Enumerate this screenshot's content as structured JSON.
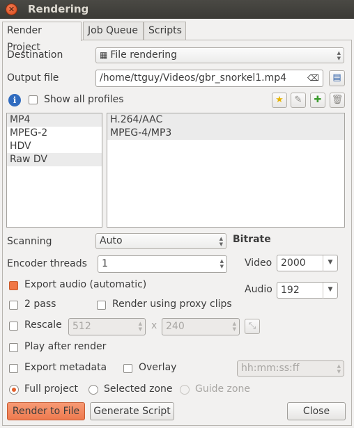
{
  "window": {
    "title": "Rendering"
  },
  "tabs": [
    "Render Project",
    "Job Queue",
    "Scripts"
  ],
  "destination": {
    "label": "Destination",
    "value": "File rendering"
  },
  "output": {
    "label": "Output file",
    "value": "/home/ttguy/Videos/gbr_snorkel1.mp4"
  },
  "profiles": {
    "show_all_label": "Show all profiles",
    "formats": [
      "MP4",
      "MPEG-2",
      "HDV",
      "Raw DV"
    ],
    "codecs": [
      "H.264/AAC",
      "MPEG-4/MP3"
    ]
  },
  "scanning": {
    "label": "Scanning",
    "value": "Auto"
  },
  "encoder": {
    "label": "Encoder threads",
    "value": "1"
  },
  "bitrate": {
    "title": "Bitrate",
    "video_label": "Video",
    "video_value": "2000",
    "audio_label": "Audio",
    "audio_value": "192"
  },
  "options": {
    "export_audio": "Export audio (automatic)",
    "two_pass": "2 pass",
    "proxy": "Render using proxy clips",
    "rescale": "Rescale",
    "rescale_w": "512",
    "rescale_x": "x",
    "rescale_h": "240",
    "play_after": "Play after render",
    "export_metadata": "Export metadata",
    "overlay": "Overlay",
    "overlay_value": "hh:mm:ss:ff"
  },
  "zones": {
    "full": "Full project",
    "selected": "Selected zone",
    "guide": "Guide zone"
  },
  "buttons": {
    "render": "Render to File",
    "generate": "Generate Script",
    "close": "Close"
  },
  "colors": {
    "accent": "#f07746",
    "titlebar": "#3b3a36"
  }
}
